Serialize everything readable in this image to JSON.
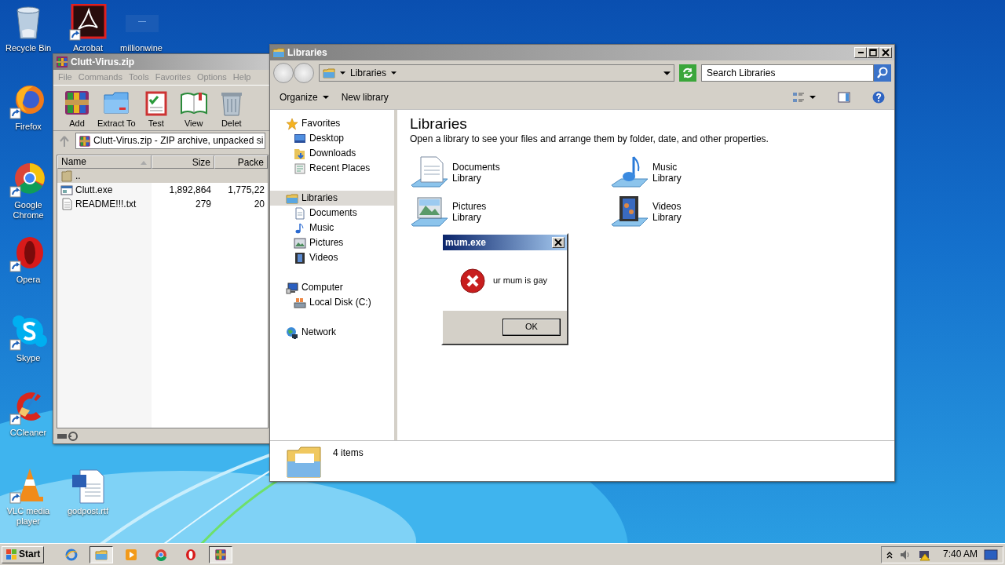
{
  "desktop_icons": [
    {
      "label": "Recycle Bin"
    },
    {
      "label": "Acrobat"
    },
    {
      "label": "millionwine"
    },
    {
      "label": "Firefox"
    },
    {
      "label": "Google Chrome"
    },
    {
      "label": "Opera"
    },
    {
      "label": "Skype"
    },
    {
      "label": "CCleaner"
    },
    {
      "label": "VLC media player"
    },
    {
      "label": "godpost.rtf"
    }
  ],
  "archive_window": {
    "title": "Clutt-Virus.zip",
    "menu": [
      "File",
      "Commands",
      "Tools",
      "Favorites",
      "Options",
      "Help"
    ],
    "toolbar": [
      "Add",
      "Extract To",
      "Test",
      "View",
      "Delet"
    ],
    "path": "Clutt-Virus.zip - ZIP archive, unpacked si",
    "columns": [
      "Name",
      "Size",
      "Packe"
    ],
    "rows": [
      {
        "kind": "parent",
        "name": ".."
      },
      {
        "kind": "program",
        "name": "Clutt.exe",
        "size": "1,892,864",
        "packed": "1,775,22"
      },
      {
        "kind": "text",
        "name": "README!!!.txt",
        "size": "279",
        "packed": "20"
      }
    ]
  },
  "explorer_window": {
    "title": "Libraries",
    "breadcrumb": "Libraries",
    "search": {
      "placeholder": "Search Libraries"
    },
    "toolbar": [
      {
        "label": "Organize",
        "menu": true
      },
      {
        "label": "New library",
        "menu": false
      }
    ],
    "nav": [
      {
        "label": "Favorites",
        "selected": false,
        "children": [
          {
            "label": "Desktop",
            "selected": false
          },
          {
            "label": "Downloads",
            "selected": false
          },
          {
            "label": "Recent Places",
            "selected": false
          }
        ]
      },
      {
        "label": "Libraries",
        "selected": true,
        "children": [
          {
            "label": "Documents",
            "selected": false
          },
          {
            "label": "Music",
            "selected": false
          },
          {
            "label": "Pictures",
            "selected": false
          },
          {
            "label": "Videos",
            "selected": false
          }
        ]
      },
      {
        "label": "Computer",
        "selected": false,
        "children": [
          {
            "label": "Local Disk (C:)",
            "selected": false
          }
        ]
      },
      {
        "label": "Network",
        "selected": false
      }
    ],
    "heading": "Libraries",
    "description": "Open a library to see your files and arrange them by folder, date, and other properties.",
    "libraries": [
      {
        "name": "Documents",
        "type": "Library"
      },
      {
        "name": "Music",
        "type": "Library"
      },
      {
        "name": "Pictures",
        "type": "Library"
      },
      {
        "name": "Videos",
        "type": "Library"
      }
    ],
    "status": "4 items"
  },
  "dialog": {
    "title": "mum.exe",
    "message": "ur mum is gay",
    "button": "OK"
  },
  "taskbar": {
    "start": "Start",
    "apps": [
      {
        "open": false
      },
      {
        "open": true
      },
      {
        "open": false
      },
      {
        "open": false
      },
      {
        "open": false
      },
      {
        "open": true
      }
    ],
    "clock": "7:40 AM"
  }
}
